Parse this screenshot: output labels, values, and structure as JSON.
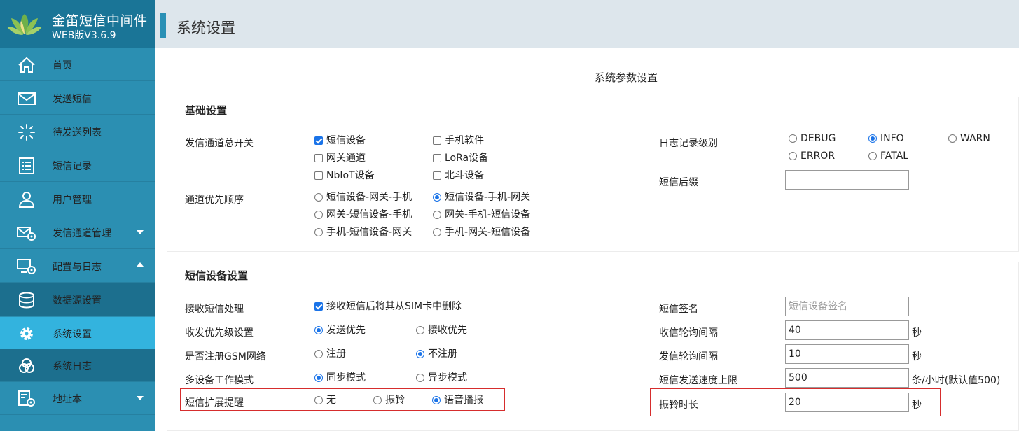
{
  "app": {
    "title": "金笛短信中间件",
    "version": "WEB版V3.6.9"
  },
  "sidebar": {
    "items": [
      {
        "label": "首页",
        "icon": "home-icon"
      },
      {
        "label": "发送短信",
        "icon": "envelope-icon"
      },
      {
        "label": "待发送列表",
        "icon": "loading-spinner-icon"
      },
      {
        "label": "短信记录",
        "icon": "list-icon"
      },
      {
        "label": "用户管理",
        "icon": "user-icon"
      },
      {
        "label": "发信通道管理",
        "icon": "envelope-gear-icon"
      },
      {
        "label": "配置与日志",
        "icon": "monitor-gear-icon"
      },
      {
        "label": "数据源设置",
        "icon": "database-icon"
      },
      {
        "label": "系统设置",
        "icon": "gear-icon"
      },
      {
        "label": "系统日志",
        "icon": "log-circles-icon"
      },
      {
        "label": "地址本",
        "icon": "address-book-gear-icon"
      }
    ]
  },
  "header": {
    "title": "系统设置"
  },
  "page": {
    "heading": "系统参数设置"
  },
  "basic": {
    "title": "基础设置",
    "channel_switch_label": "发信通道总开关",
    "channels": [
      {
        "label": "短信设备",
        "checked": true
      },
      {
        "label": "手机软件",
        "checked": false
      },
      {
        "label": "网关通道",
        "checked": false
      },
      {
        "label": "LoRa设备",
        "checked": false
      },
      {
        "label": "NbIoT设备",
        "checked": false
      },
      {
        "label": "北斗设备",
        "checked": false
      }
    ],
    "priority_label": "通道优先顺序",
    "priorities": [
      {
        "label": "短信设备-网关-手机",
        "checked": false
      },
      {
        "label": "短信设备-手机-网关",
        "checked": true
      },
      {
        "label": "网关-短信设备-手机",
        "checked": false
      },
      {
        "label": "网关-手机-短信设备",
        "checked": false
      },
      {
        "label": "手机-短信设备-网关",
        "checked": false
      },
      {
        "label": "手机-网关-短信设备",
        "checked": false
      }
    ],
    "log_level_label": "日志记录级别",
    "log_levels": [
      {
        "label": "DEBUG",
        "checked": false
      },
      {
        "label": "INFO",
        "checked": true
      },
      {
        "label": "WARN",
        "checked": false
      },
      {
        "label": "ERROR",
        "checked": false
      },
      {
        "label": "FATAL",
        "checked": false
      }
    ],
    "suffix_label": "短信后缀",
    "suffix_value": ""
  },
  "device": {
    "title": "短信设备设置",
    "receive_label": "接收短信处理",
    "receive_option": {
      "label": "接收短信后将其从SIM卡中删除",
      "checked": true
    },
    "priority_label": "收发优先级设置",
    "priority_options": [
      {
        "label": "发送优先",
        "checked": true
      },
      {
        "label": "接收优先",
        "checked": false
      }
    ],
    "gsm_label": "是否注册GSM网络",
    "gsm_options": [
      {
        "label": "注册",
        "checked": false
      },
      {
        "label": "不注册",
        "checked": true
      }
    ],
    "mode_label": "多设备工作模式",
    "mode_options": [
      {
        "label": "同步模式",
        "checked": true
      },
      {
        "label": "异步模式",
        "checked": false
      }
    ],
    "remind_label": "短信扩展提醒",
    "remind_options": [
      {
        "label": "无",
        "checked": false
      },
      {
        "label": "振铃",
        "checked": false
      },
      {
        "label": "语音播报",
        "checked": true
      }
    ],
    "signature_label": "短信签名",
    "signature_placeholder": "短信设备签名",
    "recv_interval_label": "收信轮询间隔",
    "recv_interval_value": "40",
    "recv_interval_unit": "秒",
    "send_interval_label": "发信轮询间隔",
    "send_interval_value": "10",
    "send_interval_unit": "秒",
    "speed_label": "短信发送速度上限",
    "speed_value": "500",
    "speed_unit": "条/小时(默认值500)",
    "ring_label": "振铃时长",
    "ring_value": "20",
    "ring_unit": "秒"
  },
  "colors": {
    "sidebar": "#2b8fb2",
    "brand": "#1a7597",
    "active": "#33b3de",
    "accent": "#2a90b5",
    "highlight": "#d62d2d"
  }
}
